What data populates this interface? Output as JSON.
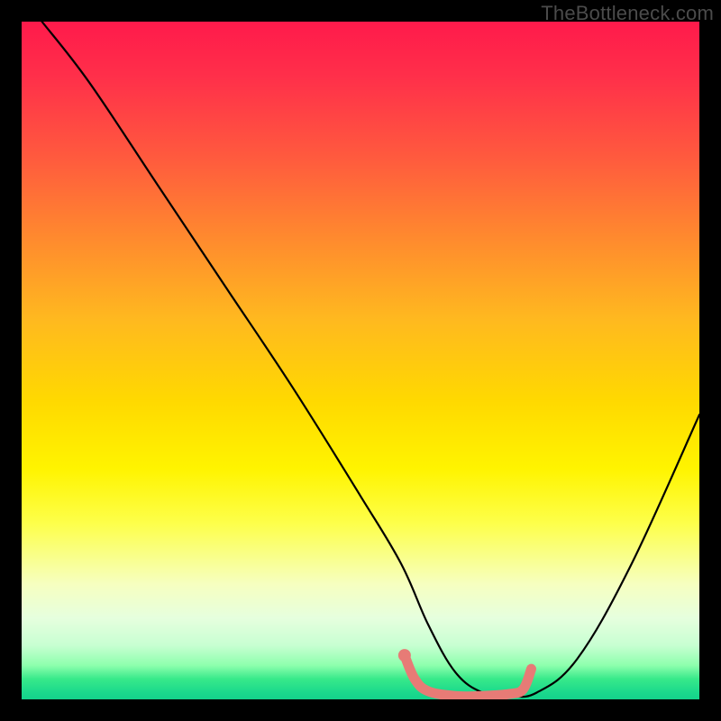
{
  "watermark": "TheBottleneck.com",
  "chart_data": {
    "type": "line",
    "title": "",
    "xlabel": "",
    "ylabel": "",
    "xlim": [
      0,
      100
    ],
    "ylim": [
      0,
      100
    ],
    "series": [
      {
        "name": "black-curve",
        "x": [
          3,
          10,
          20,
          30,
          40,
          50,
          56,
          60,
          64,
          68,
          72,
          76,
          82,
          90,
          100
        ],
        "values": [
          100,
          91,
          76,
          61,
          46,
          30,
          20,
          11,
          4,
          1,
          0.5,
          1,
          6,
          20,
          42
        ]
      },
      {
        "name": "salmon-segment",
        "x": [
          56.5,
          58,
          60,
          64,
          68,
          72,
          74,
          75.2
        ],
        "values": [
          6.5,
          3,
          1.2,
          0.5,
          0.5,
          0.8,
          1.5,
          4.5
        ]
      }
    ],
    "points": [
      {
        "name": "salmon-start-dot",
        "x": 56.5,
        "y": 6.5
      }
    ],
    "colors": {
      "curve": "#000000",
      "accent": "#e77b76",
      "gradient_top": "#ff1a4b",
      "gradient_bottom": "#14d28b"
    }
  }
}
